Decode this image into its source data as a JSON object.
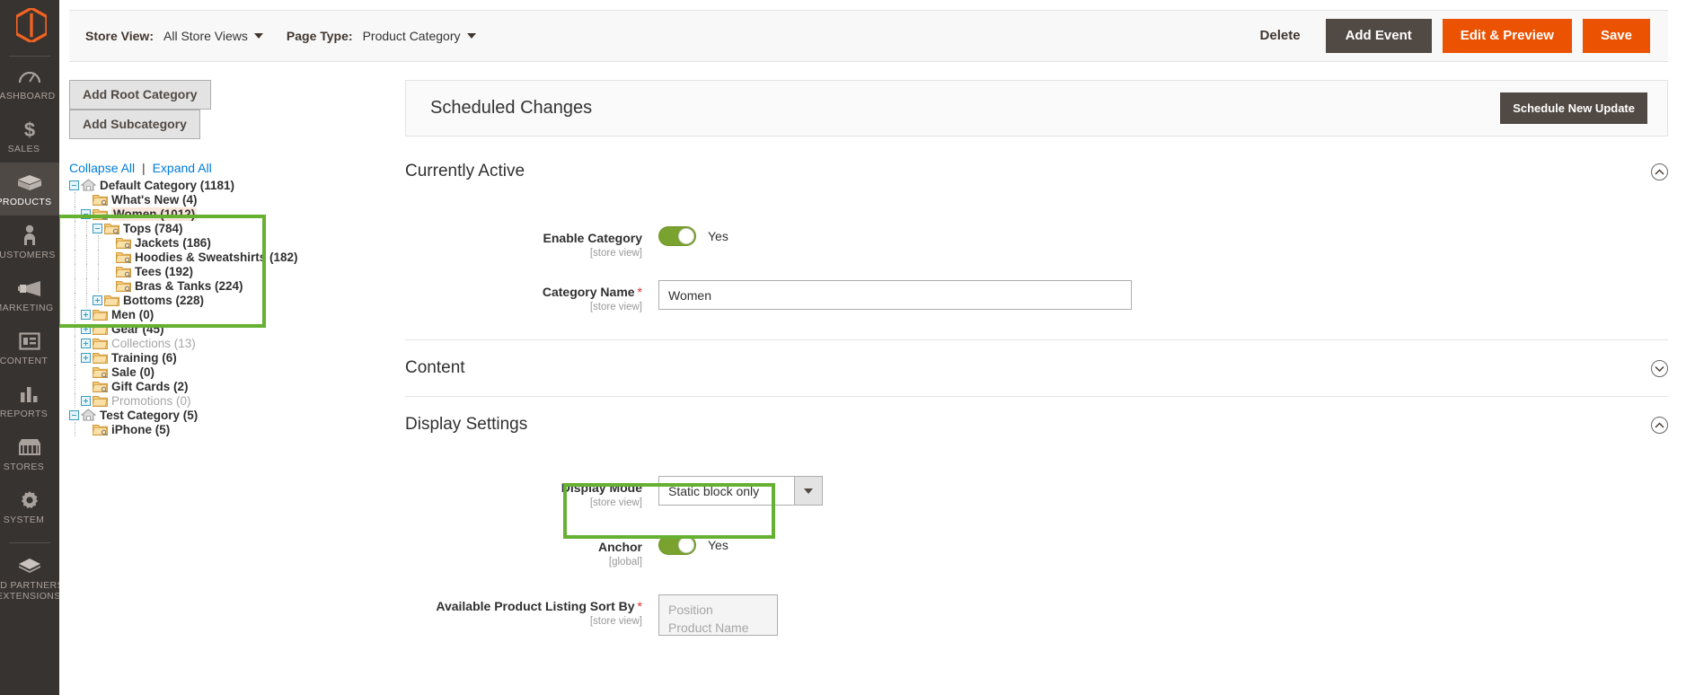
{
  "nav": {
    "logo_alt": "magento-logo",
    "items": [
      {
        "label": "DASHBOARD",
        "icon": "dashboard-icon",
        "active": false
      },
      {
        "label": "SALES",
        "icon": "dollar-icon",
        "active": false
      },
      {
        "label": "PRODUCTS",
        "icon": "box-icon",
        "active": true
      },
      {
        "label": "CUSTOMERS",
        "icon": "person-icon",
        "active": false
      },
      {
        "label": "MARKETING",
        "icon": "megaphone-icon",
        "active": false
      },
      {
        "label": "CONTENT",
        "icon": "layout-icon",
        "active": false
      },
      {
        "label": "REPORTS",
        "icon": "bar-chart-icon",
        "active": false
      },
      {
        "label": "STORES",
        "icon": "storefront-icon",
        "active": false
      },
      {
        "label": "SYSTEM",
        "icon": "gear-icon",
        "active": false
      },
      {
        "label": "FIND PARTNERS & EXTENSIONS",
        "label_line1": "FIND PARTNERS",
        "label_line2": "& EXTENSIONS",
        "icon": "extension-icon",
        "active": false
      }
    ]
  },
  "topbar": {
    "store_view_label": "Store View:",
    "store_view_value": "All Store Views",
    "page_type_label": "Page Type:",
    "page_type_value": "Product Category",
    "delete_label": "Delete",
    "add_event_label": "Add Event",
    "edit_preview_label": "Edit & Preview",
    "save_label": "Save"
  },
  "tree_panel": {
    "add_root_label": "Add Root Category",
    "add_sub_label": "Add Subcategory",
    "collapse_all": "Collapse All",
    "expand_all": "Expand All",
    "separator": "|",
    "nodes": [
      {
        "label": "Default Category (1181)",
        "depth": 0,
        "toggle": "minus",
        "icon": "home-icon",
        "state": "normal"
      },
      {
        "label": "What's New (4)",
        "depth": 1,
        "toggle": "none",
        "icon": "folder-icon",
        "state": "normal"
      },
      {
        "label": "Women (1012)",
        "depth": 1,
        "toggle": "minus",
        "icon": "folder-icon",
        "state": "selected"
      },
      {
        "label": "Tops (784)",
        "depth": 2,
        "toggle": "minus",
        "icon": "folder-icon",
        "state": "normal"
      },
      {
        "label": "Jackets (186)",
        "depth": 3,
        "toggle": "none",
        "icon": "folder-icon",
        "state": "normal"
      },
      {
        "label": "Hoodies & Sweatshirts (182)",
        "depth": 3,
        "toggle": "none",
        "icon": "folder-icon",
        "state": "normal"
      },
      {
        "label": "Tees (192)",
        "depth": 3,
        "toggle": "none",
        "icon": "folder-icon",
        "state": "normal"
      },
      {
        "label": "Bras & Tanks (224)",
        "depth": 3,
        "toggle": "none",
        "icon": "folder-icon",
        "state": "normal"
      },
      {
        "label": "Bottoms (228)",
        "depth": 2,
        "toggle": "plus",
        "icon": "folder-icon",
        "state": "normal"
      },
      {
        "label": "Men (0)",
        "depth": 1,
        "toggle": "plus",
        "icon": "folder-icon",
        "state": "normal"
      },
      {
        "label": "Gear (45)",
        "depth": 1,
        "toggle": "plus",
        "icon": "folder-icon",
        "state": "normal"
      },
      {
        "label": "Collections (13)",
        "depth": 1,
        "toggle": "plus",
        "icon": "folder-icon",
        "state": "disabled"
      },
      {
        "label": "Training (6)",
        "depth": 1,
        "toggle": "plus",
        "icon": "folder-icon",
        "state": "normal"
      },
      {
        "label": "Sale (0)",
        "depth": 1,
        "toggle": "none",
        "icon": "folder-icon",
        "state": "normal"
      },
      {
        "label": "Gift Cards (2)",
        "depth": 1,
        "toggle": "none",
        "icon": "folder-icon",
        "state": "normal"
      },
      {
        "label": "Promotions (0)",
        "depth": 1,
        "toggle": "plus",
        "icon": "folder-icon",
        "state": "disabled"
      },
      {
        "label": "Test Category (5)",
        "depth": 0,
        "toggle": "minus",
        "icon": "home-icon",
        "state": "normal"
      },
      {
        "label": "iPhone (5)",
        "depth": 1,
        "toggle": "none",
        "icon": "folder-icon",
        "state": "normal"
      }
    ]
  },
  "scheduled": {
    "title": "Scheduled Changes",
    "button_label": "Schedule New Update"
  },
  "sections": {
    "currently_active": {
      "title": "Currently Active",
      "chevron": "chevron-up",
      "enable_category": {
        "label": "Enable Category",
        "scope": "[store view]",
        "value": "Yes",
        "on": true
      },
      "category_name": {
        "label": "Category Name",
        "required": "*",
        "scope": "[store view]",
        "value": "Women"
      }
    },
    "content": {
      "title": "Content",
      "chevron": "chevron-down"
    },
    "display_settings": {
      "title": "Display Settings",
      "chevron": "chevron-up",
      "display_mode": {
        "label": "Display Mode",
        "scope": "[store view]",
        "value": "Static block only"
      },
      "anchor": {
        "label": "Anchor",
        "scope": "[global]",
        "value": "Yes",
        "on": true
      },
      "sort_by": {
        "label": "Available Product Listing Sort By",
        "required": "*",
        "scope": "[store view]",
        "options": [
          "Position",
          "Product Name"
        ]
      }
    }
  },
  "colors": {
    "brand_orange": "#eb5202",
    "dark_brown": "#514943",
    "nav_bg": "#373330",
    "toggle_green": "#79a22e",
    "highlight_green": "#66b032",
    "link_blue": "#007bdb",
    "selected_row": "#fbe6dc"
  }
}
